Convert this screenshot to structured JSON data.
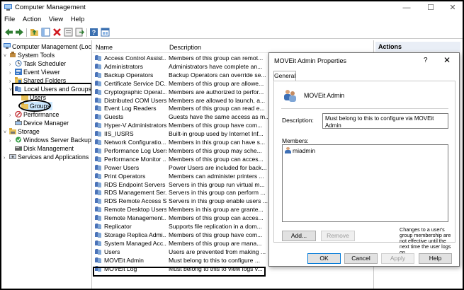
{
  "window": {
    "title": "Computer Management",
    "min_glyph": "—",
    "max_glyph": "☐",
    "close_glyph": "✕"
  },
  "menu": [
    "File",
    "Action",
    "View",
    "Help"
  ],
  "toolbar": {
    "icons": [
      "back-icon",
      "forward-icon",
      "up-folder-icon",
      "show-hide-tree-icon",
      "delete-icon",
      "properties-icon",
      "export-list-icon",
      "help-icon",
      "console-tree-icon"
    ]
  },
  "tree": {
    "items": [
      {
        "label": "Computer Management (Local",
        "arrow": "",
        "icon": "computer-management-icon"
      },
      {
        "label": "System Tools",
        "arrow": "˅",
        "icon": "system-tools-icon"
      },
      {
        "label": "Task Scheduler",
        "arrow": "›",
        "icon": "task-scheduler-icon"
      },
      {
        "label": "Event Viewer",
        "arrow": "›",
        "icon": "event-viewer-icon"
      },
      {
        "label": "Shared Folders",
        "arrow": "›",
        "icon": "shared-folders-icon"
      },
      {
        "label": "Local Users and Groups",
        "arrow": "˅",
        "icon": "local-users-groups-icon"
      },
      {
        "label": "Users",
        "arrow": "",
        "icon": "folder-icon"
      },
      {
        "label": "Groups",
        "arrow": "",
        "icon": "folder-icon"
      },
      {
        "label": "Performance",
        "arrow": "›",
        "icon": "performance-icon"
      },
      {
        "label": "Device Manager",
        "arrow": "",
        "icon": "device-manager-icon"
      },
      {
        "label": "Storage",
        "arrow": "˅",
        "icon": "storage-icon"
      },
      {
        "label": "Windows Server Backup",
        "arrow": "›",
        "icon": "server-backup-icon"
      },
      {
        "label": "Disk Management",
        "arrow": "",
        "icon": "disk-management-icon"
      },
      {
        "label": "Services and Applications",
        "arrow": "›",
        "icon": "services-icon"
      }
    ]
  },
  "list": {
    "headers": {
      "name": "Name",
      "description": "Description"
    },
    "rows": [
      {
        "name": "Access Control Assist...",
        "description": "Members of this group can remot..."
      },
      {
        "name": "Administrators",
        "description": "Administrators have complete an..."
      },
      {
        "name": "Backup Operators",
        "description": "Backup Operators can override se..."
      },
      {
        "name": "Certificate Service DC...",
        "description": "Members of this group are allowe..."
      },
      {
        "name": "Cryptographic Operat...",
        "description": "Members are authorized to perfor..."
      },
      {
        "name": "Distributed COM Users",
        "description": "Members are allowed to launch, a..."
      },
      {
        "name": "Event Log Readers",
        "description": "Members of this group can read e..."
      },
      {
        "name": "Guests",
        "description": "Guests have the same access as m..."
      },
      {
        "name": "Hyper-V Administrators",
        "description": "Members of this group have com..."
      },
      {
        "name": "IIS_IUSRS",
        "description": "Built-in group used by Internet Inf..."
      },
      {
        "name": "Network Configuratio...",
        "description": "Members in this group can have s..."
      },
      {
        "name": "Performance Log Users",
        "description": "Members of this group may sche..."
      },
      {
        "name": "Performance Monitor ...",
        "description": "Members of this group can acces..."
      },
      {
        "name": "Power Users",
        "description": "Power Users are included for back..."
      },
      {
        "name": "Print Operators",
        "description": "Members can administer printers ..."
      },
      {
        "name": "RDS Endpoint Servers",
        "description": "Servers in this group run virtual m..."
      },
      {
        "name": "RDS Management Ser...",
        "description": "Servers in this group can perform ..."
      },
      {
        "name": "RDS Remote Access S...",
        "description": "Servers in this group enable users ..."
      },
      {
        "name": "Remote Desktop Users",
        "description": "Members in this group are grante..."
      },
      {
        "name": "Remote Management...",
        "description": "Members of this group can acces..."
      },
      {
        "name": "Replicator",
        "description": "Supports file replication in a dom..."
      },
      {
        "name": "Storage Replica Admi...",
        "description": "Members of this group have com..."
      },
      {
        "name": "System Managed Acc...",
        "description": "Members of this group are mana..."
      },
      {
        "name": "Users",
        "description": "Users are prevented from making ..."
      },
      {
        "name": "MOVEit Admin",
        "description": "Must belong to this to configure ..."
      },
      {
        "name": "MOVEit Log",
        "description": "Must belong to this to view logs v..."
      }
    ]
  },
  "actions": {
    "header": "Actions"
  },
  "dialog": {
    "title": "MOVEit Admin Properties",
    "help_glyph": "?",
    "close_glyph": "✕",
    "tab": "General",
    "group_name": "MOVEit Admin",
    "description_label": "Description:",
    "description_value": "Must belong to this to configure via MOVEit Admin",
    "members_label": "Members:",
    "members": [
      "miadmin"
    ],
    "add_label": "Add...",
    "remove_label": "Remove",
    "note": "Changes to a user's group membership are not effective until the next time the user logs on.",
    "ok_label": "OK",
    "cancel_label": "Cancel",
    "apply_label": "Apply",
    "help_label": "Help"
  },
  "colors": {
    "accent": "#0078d7",
    "tree_selected": "#cce8ff",
    "group_icon_dark": "#4a72b8",
    "group_icon_light": "#7fa6d6"
  }
}
